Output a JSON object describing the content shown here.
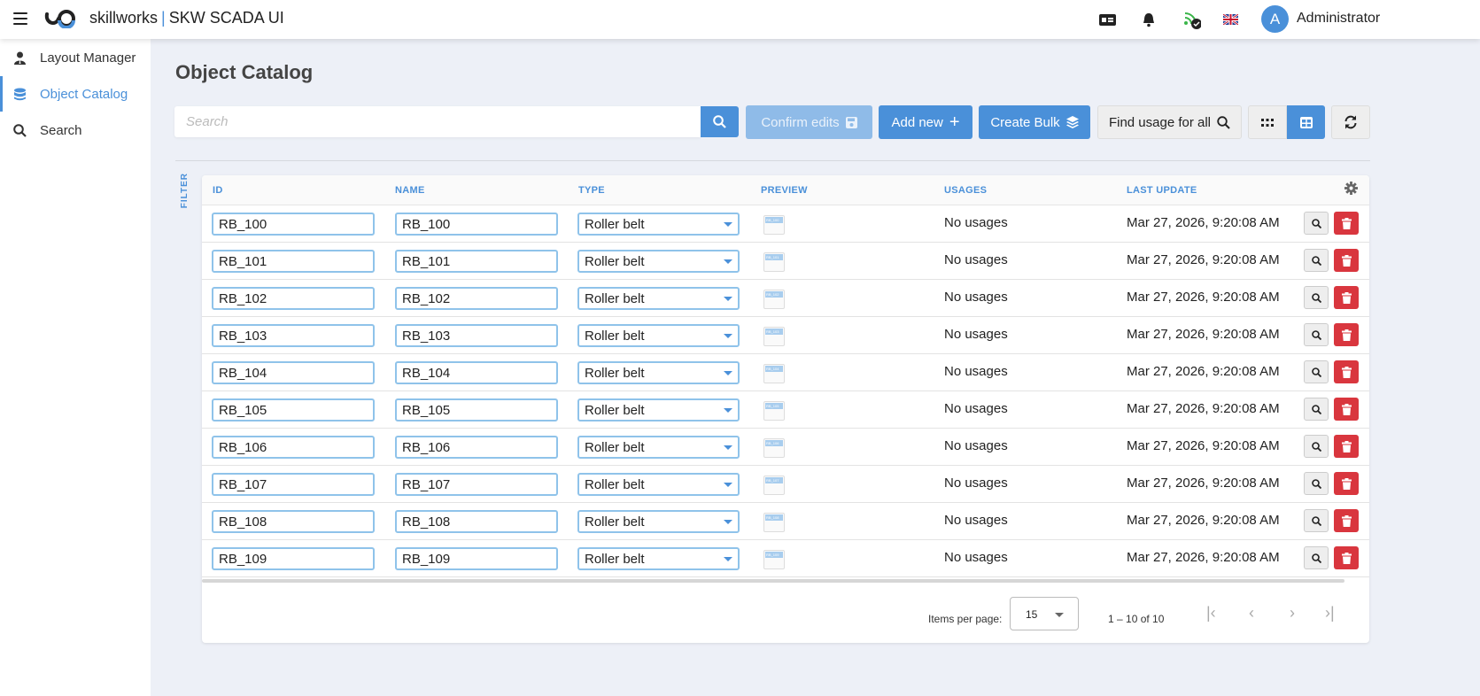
{
  "header": {
    "brand": "skillworks",
    "app_title": "SKW SCADA UI",
    "user_initial": "A",
    "user_name": "Administrator"
  },
  "sidebar": {
    "items": [
      {
        "label": "Layout Manager",
        "icon": "user-tie-icon"
      },
      {
        "label": "Object Catalog",
        "icon": "database-icon",
        "active": true
      },
      {
        "label": "Search",
        "icon": "search-icon"
      }
    ]
  },
  "page": {
    "title": "Object Catalog"
  },
  "toolbar": {
    "search_placeholder": "Search",
    "confirm_label": "Confirm edits",
    "add_label": "Add new",
    "bulk_label": "Create Bulk",
    "find_usage_label": "Find usage for all"
  },
  "filter_label": "FILTER",
  "table": {
    "columns": [
      "ID",
      "NAME",
      "TYPE",
      "PREVIEW",
      "USAGES",
      "LAST UPDATE"
    ],
    "rows": [
      {
        "id": "RB_100",
        "name": "RB_100",
        "type": "Roller belt",
        "usages": "No usages",
        "updated": "Mar 27, 2026, 9:20:08 AM"
      },
      {
        "id": "RB_101",
        "name": "RB_101",
        "type": "Roller belt",
        "usages": "No usages",
        "updated": "Mar 27, 2026, 9:20:08 AM"
      },
      {
        "id": "RB_102",
        "name": "RB_102",
        "type": "Roller belt",
        "usages": "No usages",
        "updated": "Mar 27, 2026, 9:20:08 AM"
      },
      {
        "id": "RB_103",
        "name": "RB_103",
        "type": "Roller belt",
        "usages": "No usages",
        "updated": "Mar 27, 2026, 9:20:08 AM"
      },
      {
        "id": "RB_104",
        "name": "RB_104",
        "type": "Roller belt",
        "usages": "No usages",
        "updated": "Mar 27, 2026, 9:20:08 AM"
      },
      {
        "id": "RB_105",
        "name": "RB_105",
        "type": "Roller belt",
        "usages": "No usages",
        "updated": "Mar 27, 2026, 9:20:08 AM"
      },
      {
        "id": "RB_106",
        "name": "RB_106",
        "type": "Roller belt",
        "usages": "No usages",
        "updated": "Mar 27, 2026, 9:20:08 AM"
      },
      {
        "id": "RB_107",
        "name": "RB_107",
        "type": "Roller belt",
        "usages": "No usages",
        "updated": "Mar 27, 2026, 9:20:08 AM"
      },
      {
        "id": "RB_108",
        "name": "RB_108",
        "type": "Roller belt",
        "usages": "No usages",
        "updated": "Mar 27, 2026, 9:20:08 AM"
      },
      {
        "id": "RB_109",
        "name": "RB_109",
        "type": "Roller belt",
        "usages": "No usages",
        "updated": "Mar 27, 2026, 9:20:08 AM"
      }
    ]
  },
  "pagination": {
    "items_per_page_label": "Items per page:",
    "items_per_page": "15",
    "range": "1 – 10 of 10"
  },
  "colors": {
    "accent": "#4a90d9",
    "danger": "#d9363e",
    "background": "#edf0f7"
  }
}
